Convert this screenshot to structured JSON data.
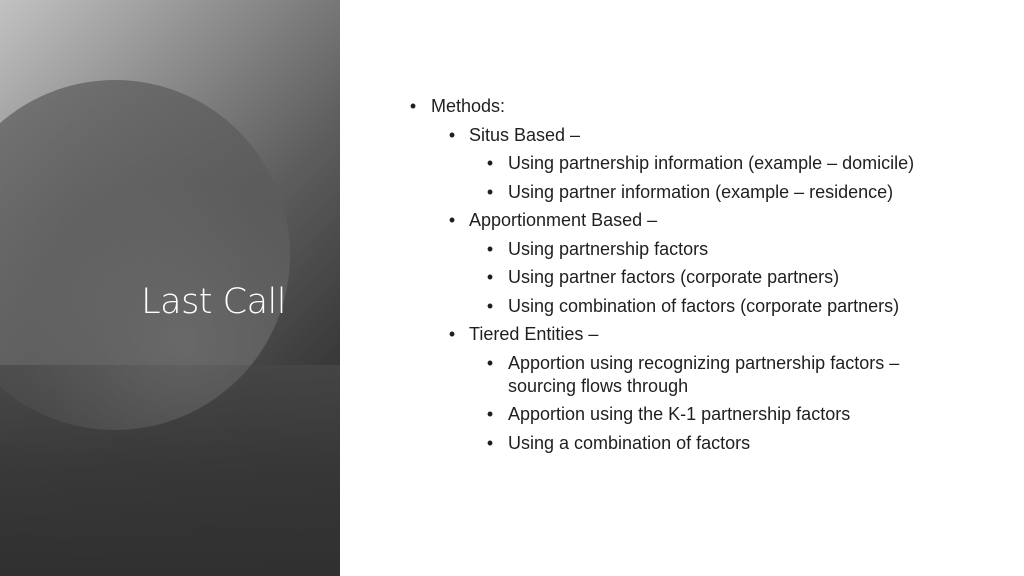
{
  "slide": {
    "title": "Last Call",
    "bullets": [
      {
        "level": 1,
        "text": "Methods:"
      },
      {
        "level": 2,
        "text": "Situs Based –"
      },
      {
        "level": 3,
        "text": "Using partnership information (example – domicile)"
      },
      {
        "level": 3,
        "text": "Using partner information (example – residence)"
      },
      {
        "level": 2,
        "text": "Apportionment Based –"
      },
      {
        "level": 3,
        "text": "Using partnership factors"
      },
      {
        "level": 3,
        "text": "Using partner factors (corporate partners)"
      },
      {
        "level": 3,
        "text": "Using combination of factors (corporate partners)"
      },
      {
        "level": 2,
        "text": "Tiered Entities –"
      },
      {
        "level": 3,
        "text": "Apportion using recognizing partnership factors – sourcing flows through"
      },
      {
        "level": 3,
        "text": "Apportion using the K-1 partnership factors"
      },
      {
        "level": 3,
        "text": "Using a combination of factors"
      }
    ],
    "bullet_glyph": "•"
  }
}
